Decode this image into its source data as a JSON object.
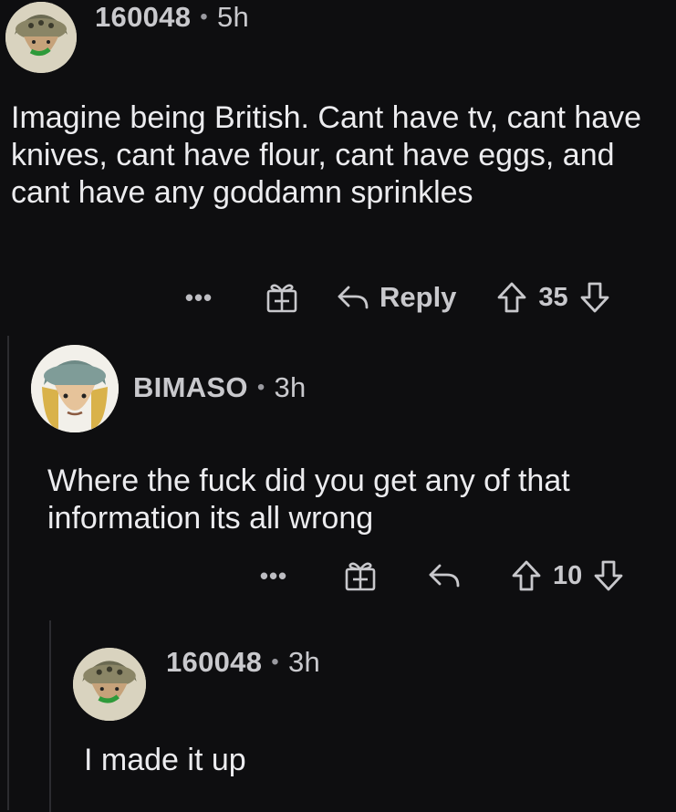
{
  "comments": [
    {
      "username": "160048",
      "separator": "•",
      "time": "5h",
      "text": "Imagine being British. Cant have tv, cant have knives, cant have flour, cant have eggs, and cant have any goddamn sprinkles",
      "actions": {
        "more": "•••",
        "reply_label": "Reply",
        "score": "35"
      }
    },
    {
      "username": "BIMASO",
      "separator": "•",
      "time": "3h",
      "text": "Where the fuck did you get any of that information its all wrong",
      "actions": {
        "more": "•••",
        "score": "10"
      }
    },
    {
      "username": "160048",
      "separator": "•",
      "time": "3h",
      "text": "I made it up"
    }
  ],
  "icons": {
    "more": "more-icon",
    "gift": "gift-award-icon",
    "reply": "reply-arrow-icon",
    "upvote": "upvote-arrow-icon",
    "downvote": "downvote-arrow-icon"
  },
  "colors": {
    "background": "#0e0e10",
    "text": "#ececef",
    "meta": "#c9c9cd"
  }
}
